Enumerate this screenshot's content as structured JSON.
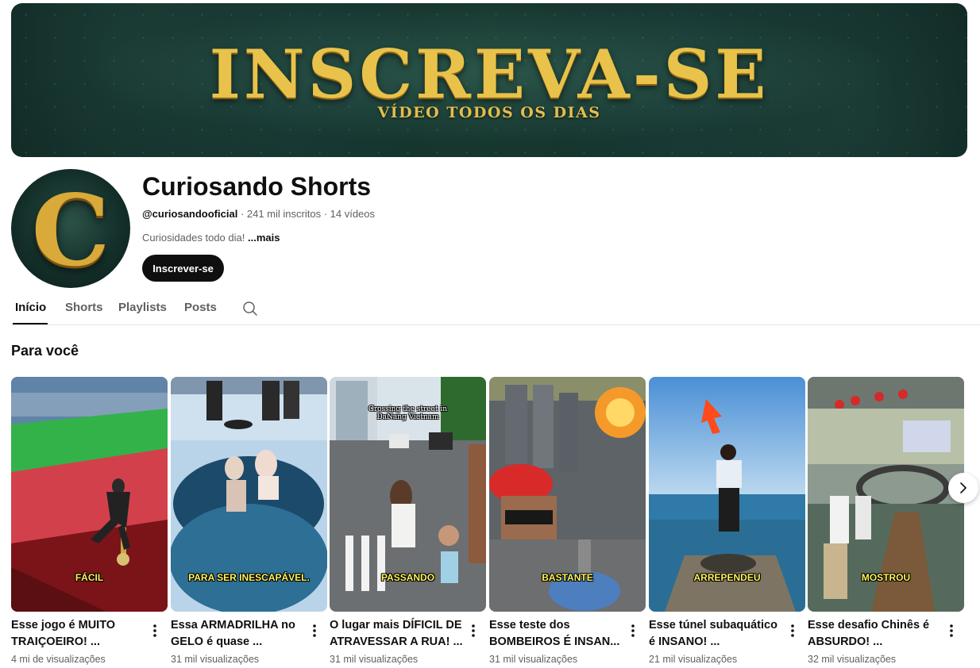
{
  "banner": {
    "title": "INSCREVA-SE",
    "subtitle": "VÍDEO TODOS OS DIAS"
  },
  "channel": {
    "avatar_letter": "C",
    "name": "Curiosando Shorts",
    "handle": "@curiosandooficial",
    "subscribers": "· 241 mil inscritos",
    "videos": "· 14 vídeos",
    "description": "Curiosidades todo dia!",
    "more_label": "...mais",
    "subscribe_label": "Inscrever-se"
  },
  "tabs": [
    {
      "label": "Início",
      "active": true
    },
    {
      "label": "Shorts"
    },
    {
      "label": "Playlists"
    },
    {
      "label": "Posts"
    }
  ],
  "section_title": "Para você",
  "shorts": [
    {
      "title": "Esse jogo é MUITO TRAIÇOEIRO! ...",
      "views": "4 mi de visualizações",
      "overlay": "FÁCIL"
    },
    {
      "title": "Essa ARMADRILHA no GELO é quase ...",
      "views": "31 mil visualizações",
      "overlay": "PARA SER INESCAPÁVEL."
    },
    {
      "title": "O lugar mais DÍFICIL DE ATRAVESSAR A RUA! ...",
      "views": "31 mil visualizações",
      "overlay": "PASSANDO",
      "top_text": "Crossing the street in DaNang Vietnam"
    },
    {
      "title": "Esse teste dos BOMBEIROS É INSAN...",
      "views": "31 mil visualizações",
      "overlay": "BASTANTE"
    },
    {
      "title": "Esse túnel subaquático é INSANO! ...",
      "views": "21 mil visualizações",
      "overlay": "ARREPENDEU"
    },
    {
      "title": "Esse desafio Chinês é ABSURDO! ...",
      "views": "32 mil visualizações",
      "overlay": "MOSTROU"
    }
  ],
  "icons": {
    "search": "search-icon",
    "more": "more-vert-icon",
    "next": "chevron-right-icon"
  }
}
